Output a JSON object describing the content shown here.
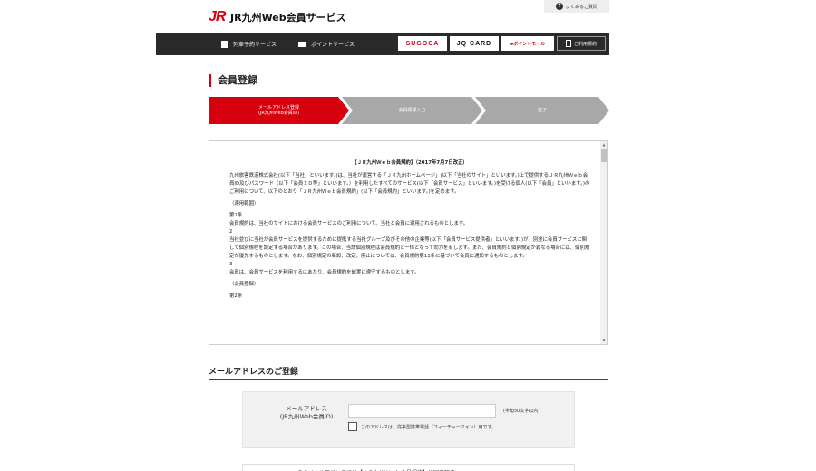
{
  "header": {
    "logo_mark": "JR",
    "site_title": "JR九州Web会員サービス",
    "faq_icon": "?",
    "faq_label": "よくあるご質問"
  },
  "nav": {
    "train_icon": "train-icon",
    "train_label": "列車予約サービス",
    "point_icon": "point-card-icon",
    "point_label": "ポイントサービス",
    "sugoca": "SUGOCA",
    "jqcard": "JQ CARD",
    "pointmall": "♣ポイントモール",
    "terms": "ご利用規約"
  },
  "page_title": "会員登録",
  "steps": [
    {
      "line1": "メールアドレス登録",
      "line2": "(JR九州Web会員ID)",
      "state": "active"
    },
    {
      "line1": "会員情報入力",
      "line2": "",
      "state": "inactive"
    },
    {
      "line1": "完了",
      "line2": "",
      "state": "inactive"
    }
  ],
  "terms": {
    "title": "【ＪＲ九州Ｗｅｂ会員規約】（2017年7月7日改正）",
    "paragraphs": [
      "九州旅客鉄道株式会社(以下「当社」といいます。)は、当社が運営する「ＪＲ九州ホームページ」(以下「当社のサイト」といいます。)上で提供するＪＲ九州Ｗｅｂ会員ID及びパスワード（以下「会員ＩＤ等」といいます。）を利用したすべてのサービス(以下「会員サービス」といいます。)を受ける個人(以下「会員」といいます。)のご利用について、以下のとおり「ＪＲ九州Ｗｅｂ会員規約」(以下「会員規約」といいます。)を定めます。",
      "（適用範囲）",
      "第1条",
      "会員規約は、当社のサイトにおける会員サービスのご利用について、当社と会員に適用されるものとします。",
      "2",
      "当社並びに当社が会員サービスを提供するために提携する当社グループ及びその他の企業等(以下「会員サービス提供者」といいます。)が、別途に会員サービスに関して個別規程を設定する場合があります。この場合、当該個別規程は会員規約と一体となって効力を有します。また、会員規約と個別規定が異なる場合には、個別規定が優先するものとします。なお、個別規定の新設、改定、廃止については、会員規約第11条に基づいて会員に通知するものとします。",
      "3",
      "会員は、会員サービスを利用するにあたり、会員規約を誠実に遵守するものとします。",
      "（会員登録）",
      "第2条"
    ]
  },
  "email_section": {
    "title": "メールアドレスのご登録",
    "label_line1": "メールアドレス",
    "label_line2": "(JR九州Web会員ID)",
    "input_value": "",
    "input_placeholder": "",
    "hint": "(半角50文字以内)",
    "checkbox_label": "このアドレスは、従来型携帯電話（フィーチャーフォン）用です。",
    "checkbox_checked": false
  },
  "bottom_note": "このメールアドレスでは【ＪＲ九州Ｗｅｂ会員規約】に同意頂き"
}
